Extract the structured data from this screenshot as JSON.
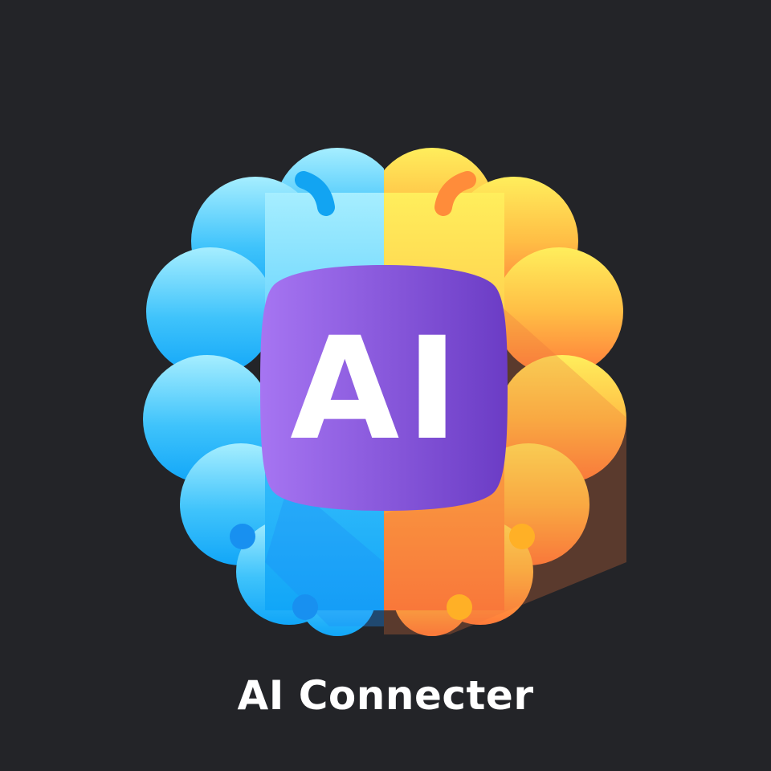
{
  "app": {
    "name": "AI Connecter",
    "icon_text": "AI"
  },
  "logo": {
    "icon": "brain-icon",
    "colors": {
      "background": "#232428",
      "left_hemisphere_top": "#9DEBFF",
      "left_hemisphere_bottom": "#12A8FA",
      "right_hemisphere_top": "#FFEB5A",
      "right_hemisphere_bottom": "#FF7A3A",
      "badge_left": "#A273F0",
      "badge_right": "#6A3BC4",
      "badge_text": "#FFFFFF"
    }
  }
}
